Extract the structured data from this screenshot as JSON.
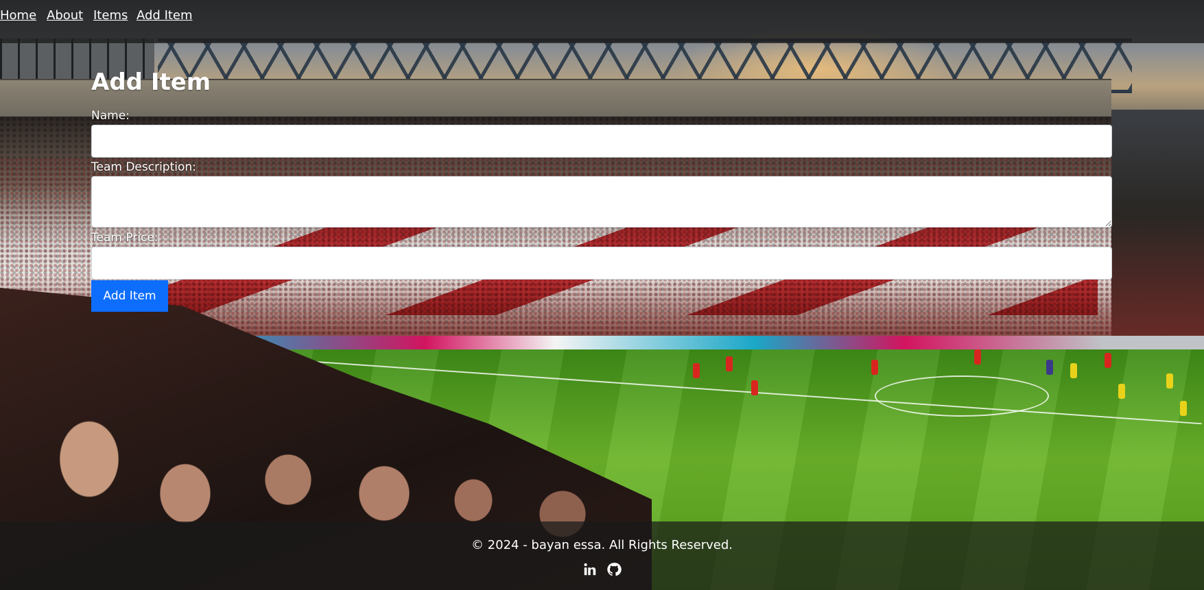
{
  "nav": {
    "items": [
      {
        "label": "Home"
      },
      {
        "label": "About"
      },
      {
        "label": "Items"
      },
      {
        "label": "Add Item"
      }
    ]
  },
  "form": {
    "title": "Add Item",
    "name_label": "Name:",
    "name_value": "",
    "description_label": "Team Description:",
    "description_value": "",
    "price_label": "Team Price:",
    "price_value": "",
    "submit_label": "Add Item"
  },
  "footer": {
    "copyright": "© 2024 - bayan essa. All Rights Reserved.",
    "social": [
      {
        "icon": "linkedin-icon"
      },
      {
        "icon": "github-icon"
      }
    ]
  },
  "colors": {
    "primary_button": "#0d6efd",
    "nav_background": "#1e1e1e",
    "text": "#ffffff"
  }
}
